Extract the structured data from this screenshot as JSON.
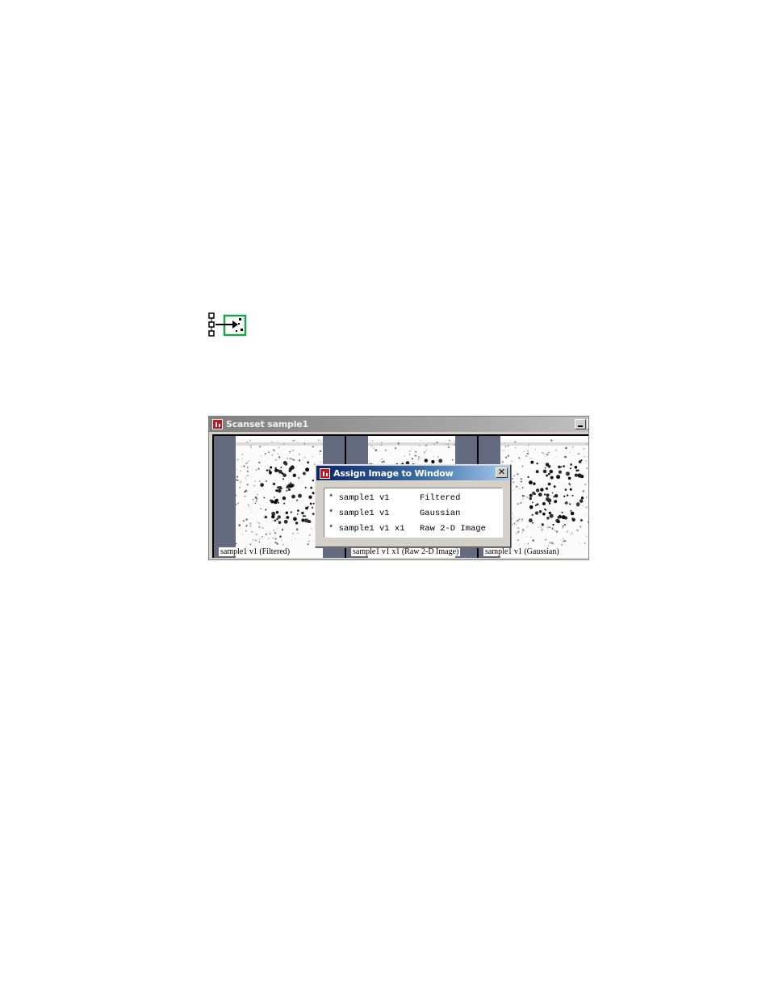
{
  "icons": {
    "assign_icon": "assign-image-to-window-icon",
    "app_icon": "app-icon"
  },
  "scanset_window": {
    "title": "Scanset sample1",
    "panes": [
      {
        "label": "sample1 v1 (Filtered)"
      },
      {
        "label": "sample1 v1 x1 (Raw 2-D Image)"
      },
      {
        "label": "sample1 v1 (Gaussian)"
      }
    ]
  },
  "dialog": {
    "title": "Assign Image to Window",
    "close_glyph": "✕",
    "items": [
      {
        "name": "* sample1 v1",
        "type": "Filtered"
      },
      {
        "name": "* sample1 v1",
        "type": "Gaussian"
      },
      {
        "name": "* sample1 v1 x1",
        "type": "Raw 2-D Image"
      }
    ]
  },
  "colors": {
    "pane_background": "#646a80",
    "dialog_title_gradient_start": "#0a246a",
    "app_icon_red": "#c8141c",
    "icon_green": "#1fa34a"
  }
}
